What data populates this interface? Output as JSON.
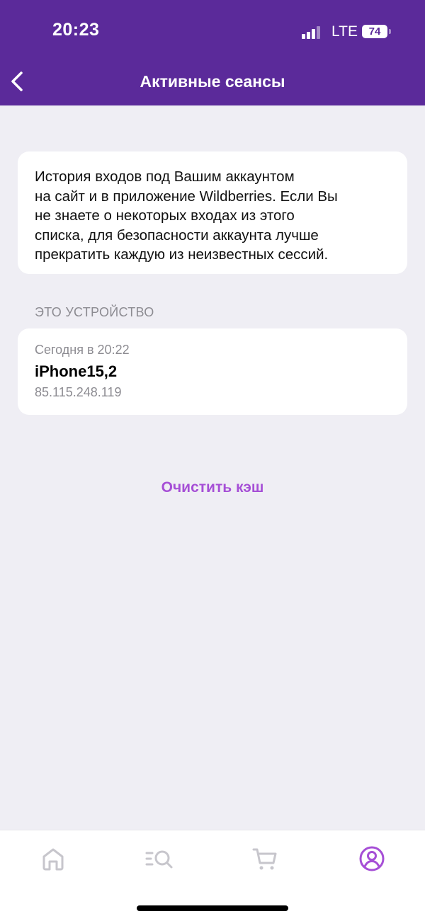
{
  "status_bar": {
    "time": "20:23",
    "network": "LTE",
    "battery": "74"
  },
  "header": {
    "title": "Активные сеансы"
  },
  "info": {
    "text": "История входов под Вашим аккаунтом\nна сайт и в приложение Wildberries. Если Вы\nне знаете о некоторых входах из этого\nсписка, для безопасности аккаунта лучше\nпрекратить каждую из неизвестных сессий."
  },
  "this_device": {
    "section_title": "ЭТО УСТРОЙСТВО",
    "time": "Сегодня в 20:22",
    "name": "iPhone15,2",
    "ip": "85.115.248.119"
  },
  "actions": {
    "clear_cache": "Очистить кэш"
  },
  "tab_bar": {
    "tabs": [
      {
        "icon": "home-icon",
        "active": false
      },
      {
        "icon": "catalog-search-icon",
        "active": false
      },
      {
        "icon": "cart-icon",
        "active": false
      },
      {
        "icon": "profile-icon",
        "active": true
      }
    ]
  },
  "colors": {
    "header_bg": "#5b2a9a",
    "accent": "#a64fd6",
    "inactive_icon": "#c7c6cc",
    "background": "#efeef4"
  }
}
